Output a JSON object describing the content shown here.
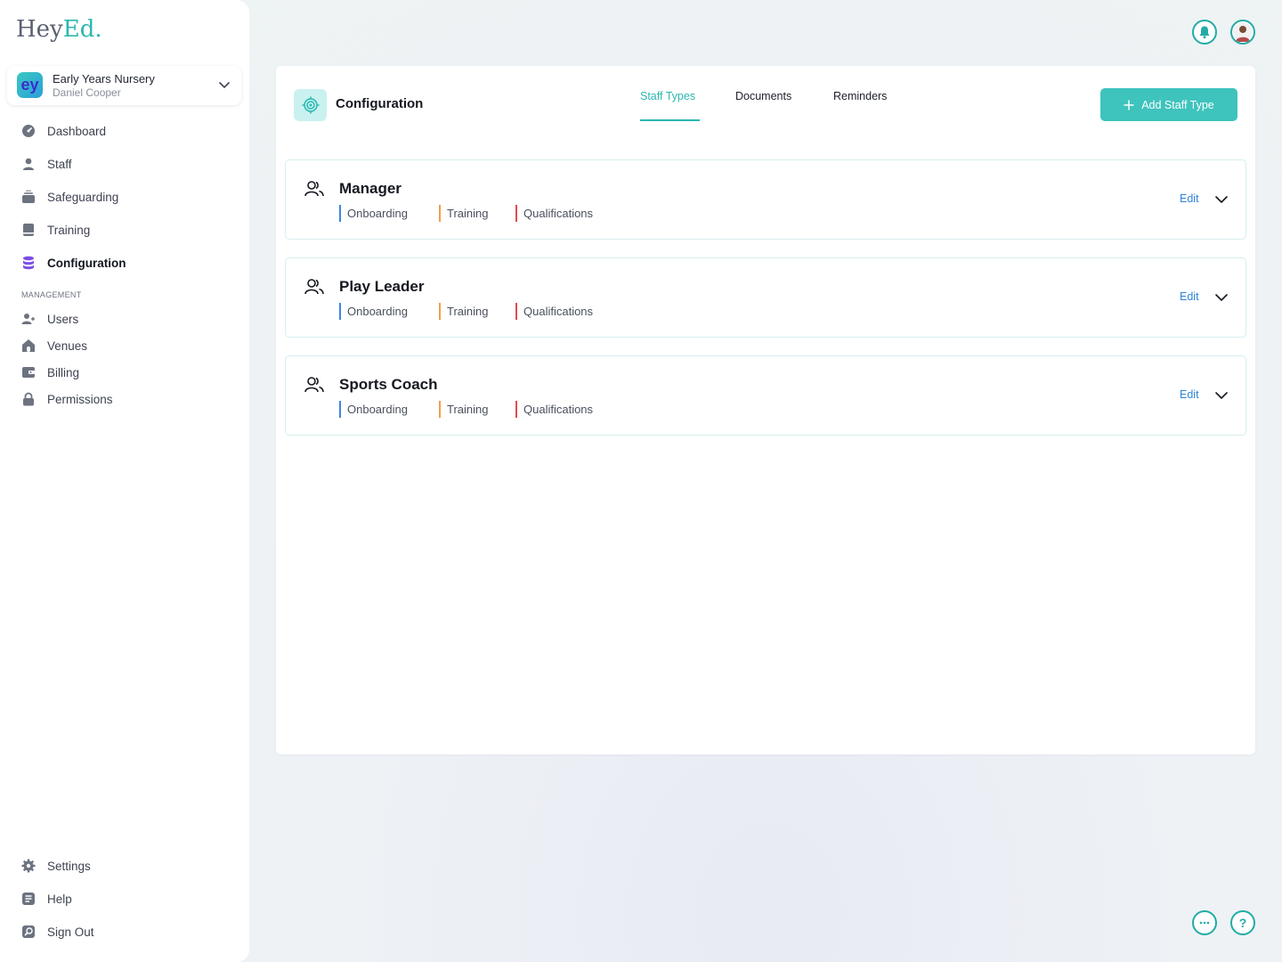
{
  "brand": {
    "name_part1": "Hey",
    "name_part2": "Ed."
  },
  "org": {
    "initials": "ey",
    "name": "Early Years Nursery",
    "user": "Daniel Cooper"
  },
  "nav": {
    "primary": [
      {
        "label": "Dashboard",
        "icon": "gauge-icon"
      },
      {
        "label": "Staff",
        "icon": "person-icon"
      },
      {
        "label": "Safeguarding",
        "icon": "stack-icon"
      },
      {
        "label": "Training",
        "icon": "book-icon"
      },
      {
        "label": "Configuration",
        "icon": "database-icon",
        "active": true
      }
    ],
    "management_label": "MANAGEMENT",
    "management": [
      {
        "label": "Users",
        "icon": "user-add-icon"
      },
      {
        "label": "Venues",
        "icon": "home-icon"
      },
      {
        "label": "Billing",
        "icon": "wallet-icon"
      },
      {
        "label": "Permissions",
        "icon": "lock-icon"
      }
    ],
    "footer": [
      {
        "label": "Settings",
        "icon": "gear-icon"
      },
      {
        "label": "Help",
        "icon": "help-doc-icon"
      },
      {
        "label": "Sign Out",
        "icon": "sign-out-icon"
      }
    ]
  },
  "page": {
    "title": "Configuration",
    "tabs": [
      {
        "label": "Staff Types",
        "active": true
      },
      {
        "label": "Documents"
      },
      {
        "label": "Reminders"
      }
    ],
    "add_button_label": "Add Staff Type"
  },
  "staff_types": [
    {
      "name": "Manager",
      "tags": [
        "Onboarding",
        "Training",
        "Qualifications"
      ],
      "edit_label": "Edit"
    },
    {
      "name": "Play Leader",
      "tags": [
        "Onboarding",
        "Training",
        "Qualifications"
      ],
      "edit_label": "Edit"
    },
    {
      "name": "Sports Coach",
      "tags": [
        "Onboarding",
        "Training",
        "Qualifications"
      ],
      "edit_label": "Edit"
    }
  ],
  "colors": {
    "accent": "#2bb7b0",
    "button": "#3fc3bd",
    "onboarding": "#3d86e6",
    "training": "#f39c4a",
    "qualifications": "#e8474c",
    "active_nav_icon": "#7b4ee6"
  }
}
